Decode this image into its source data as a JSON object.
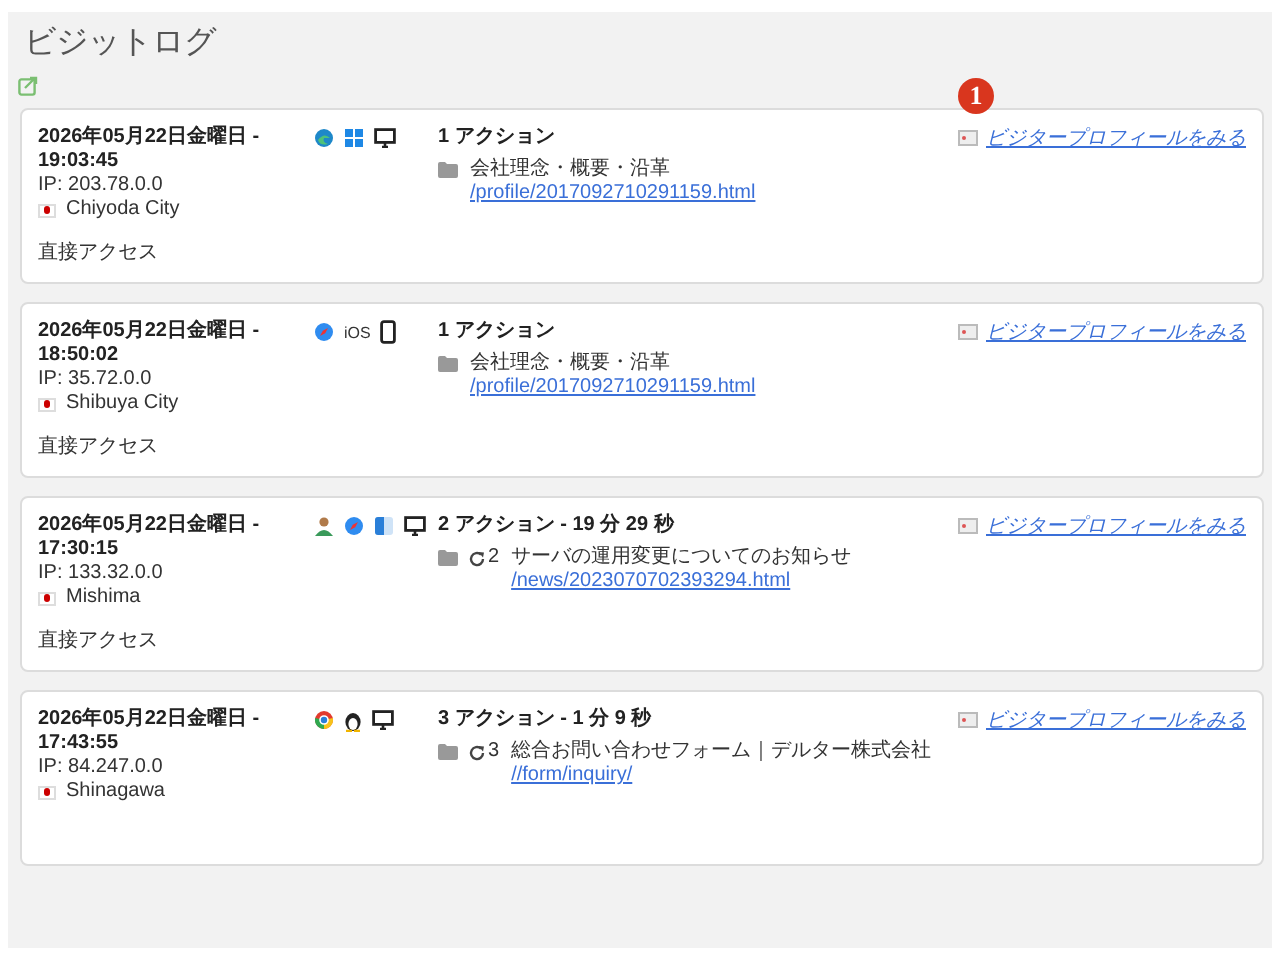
{
  "title": "ビジットログ",
  "badge": "1",
  "visits": [
    {
      "date": "2026年05月22日金曜日 -",
      "time": "19:03:45",
      "ip": "IP: 203.78.0.0",
      "city": "Chiyoda City",
      "referrer": "直接アクセス",
      "devices": [
        {
          "kind": "edge"
        },
        {
          "kind": "windows"
        },
        {
          "kind": "desktop"
        }
      ],
      "actions": "1 アクション",
      "pages": [
        {
          "title": "会社理念・概要・沿革",
          "url": "/profile/2017092710291159.html"
        }
      ],
      "profile_link": "ビジタープロフィールをみる"
    },
    {
      "date": "2026年05月22日金曜日 -",
      "time": "18:50:02",
      "ip": "IP: 35.72.0.0",
      "city": "Shibuya City",
      "referrer": "直接アクセス",
      "devices": [
        {
          "kind": "safari"
        },
        {
          "kind": "text",
          "label": "iOS"
        },
        {
          "kind": "phone"
        }
      ],
      "actions": "1 アクション",
      "pages": [
        {
          "title": "会社理念・概要・沿革",
          "url": "/profile/2017092710291159.html"
        }
      ],
      "profile_link": "ビジタープロフィールをみる"
    },
    {
      "date": "2026年05月22日金曜日 -",
      "time": "17:30:15",
      "ip": "IP: 133.32.0.0",
      "city": "Mishima",
      "referrer": "直接アクセス",
      "devices": [
        {
          "kind": "user"
        },
        {
          "kind": "safari"
        },
        {
          "kind": "finder"
        },
        {
          "kind": "desktop"
        }
      ],
      "actions": "2 アクション - 19 分 29 秒",
      "pages": [
        {
          "repeat": "2",
          "title": "サーバの運用変更についてのお知らせ",
          "url": "/news/2023070702393294.html"
        }
      ],
      "profile_link": "ビジタープロフィールをみる"
    },
    {
      "date": "2026年05月22日金曜日 -",
      "time": "17:43:55",
      "ip": "IP: 84.247.0.0",
      "city": "Shinagawa",
      "devices": [
        {
          "kind": "chrome"
        },
        {
          "kind": "linux"
        },
        {
          "kind": "desktop"
        }
      ],
      "actions": "3 アクション - 1 分 9 秒",
      "pages": [
        {
          "repeat": "3",
          "title": "総合お問い合わせフォーム｜デルター株式会社",
          "url": "//form/inquiry/"
        }
      ],
      "profile_link": "ビジタープロフィールをみる"
    }
  ]
}
